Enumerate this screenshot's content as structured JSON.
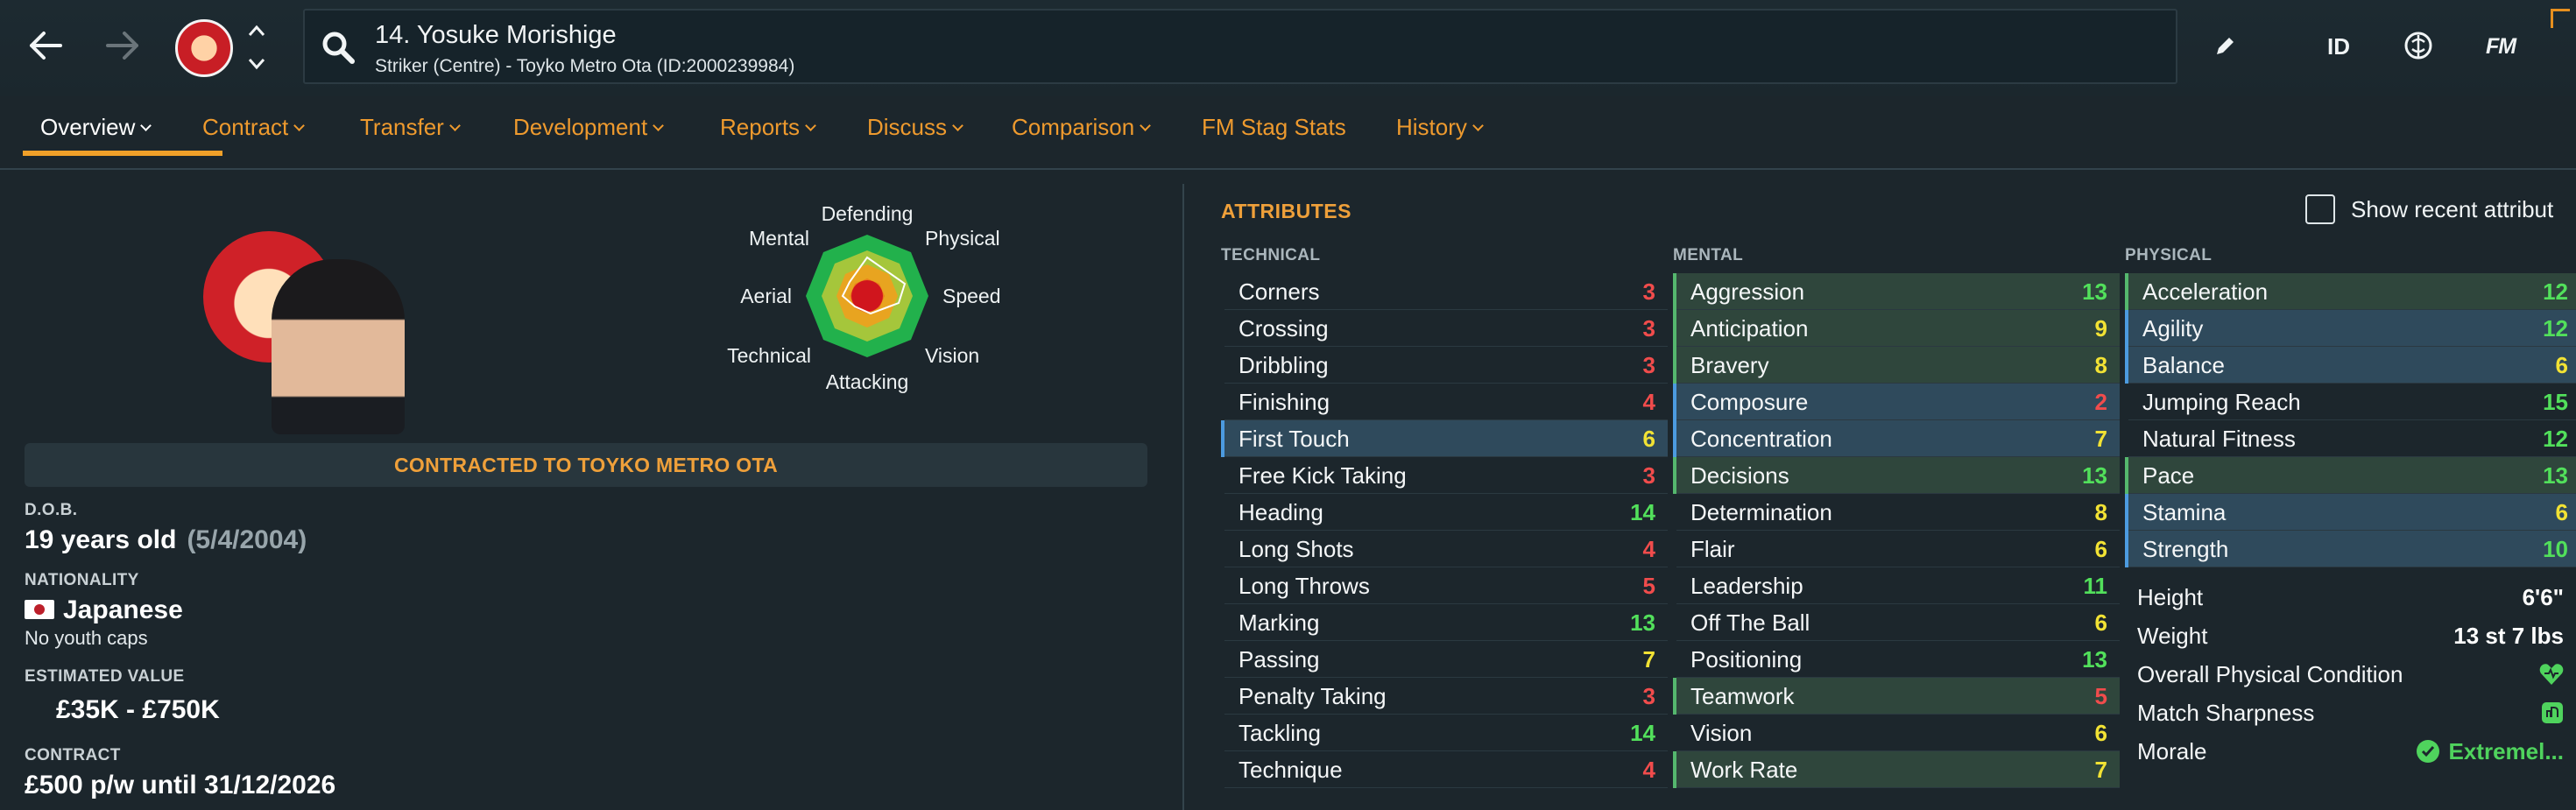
{
  "header": {
    "title": "14. Yosuke Morishige",
    "subtitle": "Striker (Centre) - Toyko Metro Ota (ID:2000239984)",
    "id_button": "ID",
    "fm_button": "FM"
  },
  "tabs": [
    {
      "label": "Overview",
      "active": true
    },
    {
      "label": "Contract"
    },
    {
      "label": "Transfer"
    },
    {
      "label": "Development"
    },
    {
      "label": "Reports"
    },
    {
      "label": "Discuss"
    },
    {
      "label": "Comparison"
    },
    {
      "label": "FM Stag Stats"
    },
    {
      "label": "History"
    }
  ],
  "profile": {
    "radar_labels": {
      "defending": "Defending",
      "physical": "Physical",
      "speed": "Speed",
      "vision": "Vision",
      "attacking": "Attacking",
      "technical": "Technical",
      "aerial": "Aerial",
      "mental": "Mental"
    },
    "contract_banner": "CONTRACTED TO TOYKO METRO OTA",
    "dob_label": "D.O.B.",
    "age": "19 years old",
    "dob_date": "(5/4/2004)",
    "nationality_label": "NATIONALITY",
    "nationality": "Japanese",
    "youth_caps": "No youth caps",
    "value_label": "ESTIMATED VALUE",
    "value": "£35K - £750K",
    "contract_label": "CONTRACT",
    "contract": "£500 p/w until 31/12/2026"
  },
  "attributes": {
    "title": "ATTRIBUTES",
    "show_recent": "Show recent attribut",
    "technical_label": "TECHNICAL",
    "mental_label": "MENTAL",
    "physical_label": "PHYSICAL",
    "technical": [
      {
        "name": "Corners",
        "value": "3"
      },
      {
        "name": "Crossing",
        "value": "3"
      },
      {
        "name": "Dribbling",
        "value": "3"
      },
      {
        "name": "Finishing",
        "value": "4"
      },
      {
        "name": "First Touch",
        "value": "6"
      },
      {
        "name": "Free Kick Taking",
        "value": "3"
      },
      {
        "name": "Heading",
        "value": "14"
      },
      {
        "name": "Long Shots",
        "value": "4"
      },
      {
        "name": "Long Throws",
        "value": "5"
      },
      {
        "name": "Marking",
        "value": "13"
      },
      {
        "name": "Passing",
        "value": "7"
      },
      {
        "name": "Penalty Taking",
        "value": "3"
      },
      {
        "name": "Tackling",
        "value": "14"
      },
      {
        "name": "Technique",
        "value": "4"
      }
    ],
    "mental": [
      {
        "name": "Aggression",
        "value": "13"
      },
      {
        "name": "Anticipation",
        "value": "9"
      },
      {
        "name": "Bravery",
        "value": "8"
      },
      {
        "name": "Composure",
        "value": "2"
      },
      {
        "name": "Concentration",
        "value": "7"
      },
      {
        "name": "Decisions",
        "value": "13"
      },
      {
        "name": "Determination",
        "value": "8"
      },
      {
        "name": "Flair",
        "value": "6"
      },
      {
        "name": "Leadership",
        "value": "11"
      },
      {
        "name": "Off The Ball",
        "value": "6"
      },
      {
        "name": "Positioning",
        "value": "13"
      },
      {
        "name": "Teamwork",
        "value": "5"
      },
      {
        "name": "Vision",
        "value": "6"
      },
      {
        "name": "Work Rate",
        "value": "7"
      }
    ],
    "physical": [
      {
        "name": "Acceleration",
        "value": "12"
      },
      {
        "name": "Agility",
        "value": "12"
      },
      {
        "name": "Balance",
        "value": "6"
      },
      {
        "name": "Jumping Reach",
        "value": "15"
      },
      {
        "name": "Natural Fitness",
        "value": "12"
      },
      {
        "name": "Pace",
        "value": "13"
      },
      {
        "name": "Stamina",
        "value": "6"
      },
      {
        "name": "Strength",
        "value": "10"
      }
    ],
    "physical_info": {
      "height_label": "Height",
      "height": "6'6\"",
      "weight_label": "Weight",
      "weight": "13 st 7 lbs",
      "condition_label": "Overall Physical Condition",
      "sharpness_label": "Match Sharpness",
      "morale_label": "Morale",
      "morale": "Extremel..."
    }
  },
  "colors": {
    "accent": "#efa03a",
    "low": "#f14c4c",
    "mid": "#f2e234",
    "high": "#52e05b"
  }
}
